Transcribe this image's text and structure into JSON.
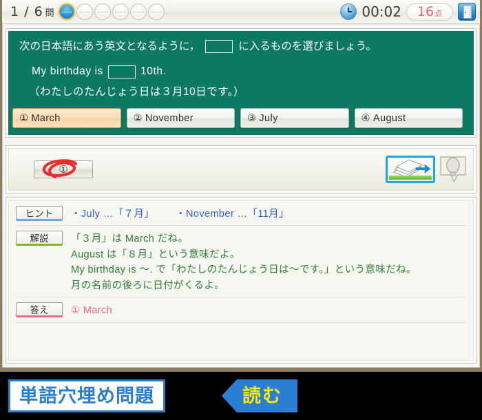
{
  "statusbar": {
    "question_counter": "1 / 6",
    "counter_unit": "問",
    "progress_total": 6,
    "progress_current": 1,
    "clock_icon": "clock-icon",
    "timer": "00:02",
    "score_value": "16",
    "score_unit": "点",
    "score_color": "#f4607f",
    "exit_icon": "door-exit-icon"
  },
  "question": {
    "panel_color": "#0c7a63",
    "instruction_before": "次の日本語にあう英文となるように，",
    "instruction_after": "に入るものを選びましょう。",
    "sentence_before": "My birthday is",
    "sentence_after": "10th.",
    "translation": "（わたしのたんじょう日は３月10日です。）",
    "choices": [
      {
        "num": "①",
        "label": "March",
        "state": "selected"
      },
      {
        "num": "②",
        "label": "November",
        "state": "normal"
      },
      {
        "num": "③",
        "label": "July",
        "state": "normal"
      },
      {
        "num": "④",
        "label": "August",
        "state": "normal"
      }
    ]
  },
  "answerbar": {
    "marked_choice": "①",
    "mark_color": "#e8302a",
    "next_button_icon": "next-page-icon",
    "hint_button_icon": "lightbulb-icon"
  },
  "explanation": {
    "hint_tag": "ヒント",
    "hint_line_1": "・July …「７月」",
    "hint_line_2": "・November …「11月」",
    "kaisetsu_tag": "解説",
    "kaisetsu_lines": [
      "「３月」は March だね。",
      "August は「８月」という意味だよ。",
      "My birthday is 〜. で「わたしのたんじょう日は〜です。」という意味だね。",
      "月の名前の後ろに日付がくるよ。"
    ],
    "kotae_tag": "答え",
    "kotae_text": "①  March"
  },
  "bottombar": {
    "subject_label": "単語穴埋め問題",
    "action_label": "読む",
    "accent_color": "#2a7fd4",
    "action_text_color": "#ffe800"
  }
}
